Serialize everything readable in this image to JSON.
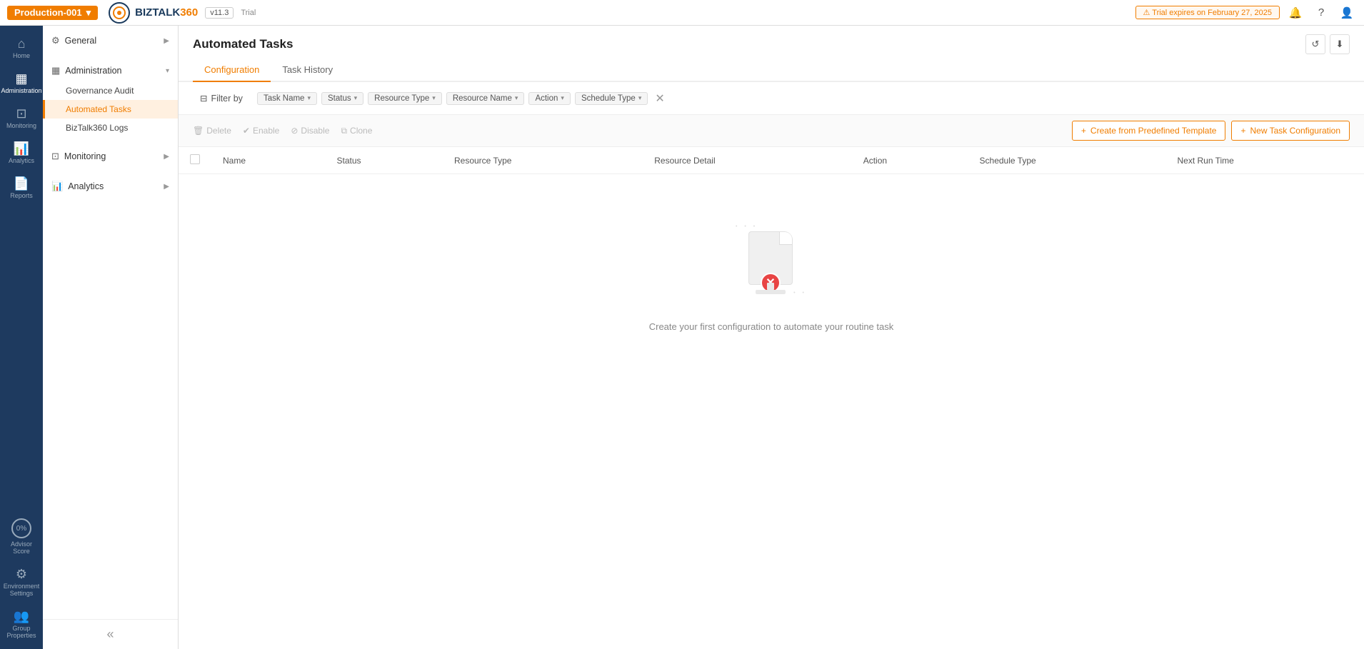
{
  "topbar": {
    "env_name": "Production-001",
    "env_chevron": "▾",
    "brand": "BIZTALK",
    "brand_360": "360",
    "version": "v11.3",
    "trial_label": "Trial",
    "trial_warning": "⚠ Trial expires on February 27, 2025",
    "date": "February 27 2025"
  },
  "sidebar": {
    "items": [
      {
        "id": "home",
        "icon": "⌂",
        "label": "Home",
        "active": false
      },
      {
        "id": "administration",
        "icon": "▦",
        "label": "Administration",
        "active": true
      },
      {
        "id": "monitoring",
        "icon": "◫",
        "label": "Monitoring",
        "active": false
      },
      {
        "id": "analytics",
        "icon": "📊",
        "label": "Analytics",
        "active": false
      },
      {
        "id": "reports",
        "icon": "📄",
        "label": "Reports",
        "active": false
      }
    ],
    "bottom_items": [
      {
        "id": "advisor-score",
        "label": "Advisor Score",
        "score": "0%"
      },
      {
        "id": "environment-settings",
        "icon": "⚙",
        "label": "Environment Settings"
      },
      {
        "id": "group-properties",
        "icon": "👥",
        "label": "Group Properties"
      }
    ]
  },
  "left_nav": {
    "sections": [
      {
        "label": "General",
        "icon": "⚙",
        "expandable": true,
        "active": false
      },
      {
        "label": "Administration",
        "icon": "▦",
        "expandable": true,
        "active": true,
        "children": [
          {
            "label": "Governance Audit",
            "active": false
          },
          {
            "label": "Automated Tasks",
            "active": true
          },
          {
            "label": "BizTalk360 Logs",
            "active": false
          }
        ]
      },
      {
        "label": "Monitoring",
        "icon": "◫",
        "expandable": true,
        "active": false
      },
      {
        "label": "Analytics",
        "icon": "📊",
        "expandable": true,
        "active": false
      }
    ]
  },
  "page": {
    "title": "Automated Tasks",
    "tabs": [
      {
        "label": "Configuration",
        "active": true
      },
      {
        "label": "Task History",
        "active": false
      }
    ],
    "filter_label": "Filter by",
    "filter_tags": [
      {
        "label": "Task Name",
        "has_chevron": true
      },
      {
        "label": "Status",
        "has_chevron": true
      },
      {
        "label": "Resource Type",
        "has_chevron": true
      },
      {
        "label": "Resource Name",
        "has_chevron": true
      },
      {
        "label": "Action",
        "has_chevron": true
      },
      {
        "label": "Schedule Type",
        "has_chevron": true
      }
    ],
    "action_buttons": [
      {
        "label": "Delete",
        "icon": "🗑",
        "disabled": true
      },
      {
        "label": "Enable",
        "icon": "✔",
        "disabled": true
      },
      {
        "label": "Disable",
        "icon": "⊘",
        "disabled": true
      },
      {
        "label": "Clone",
        "icon": "⧉",
        "disabled": true
      }
    ],
    "primary_buttons": [
      {
        "label": "Create from Predefined Template",
        "icon": "+"
      },
      {
        "label": "New Task Configuration",
        "icon": "+"
      }
    ],
    "table_columns": [
      {
        "label": ""
      },
      {
        "label": "Name"
      },
      {
        "label": "Status"
      },
      {
        "label": "Resource Type"
      },
      {
        "label": "Resource Detail"
      },
      {
        "label": "Action"
      },
      {
        "label": "Schedule Type"
      },
      {
        "label": "Next Run Time"
      }
    ],
    "empty_state": {
      "message": "Create your first configuration to automate your routine task"
    }
  }
}
